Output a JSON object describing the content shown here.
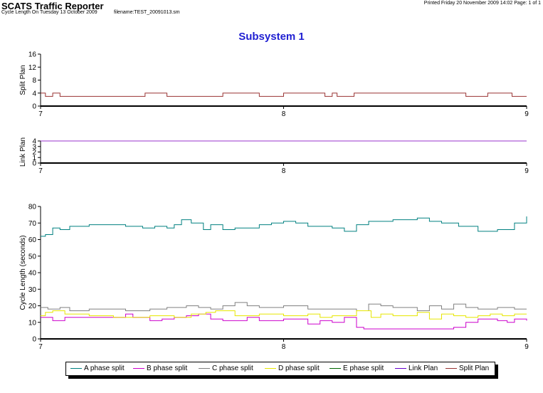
{
  "header": {
    "app_title": "SCATS Traffic Reporter",
    "subtitle": "Cycle Length On Tuesday 13 October 2009",
    "filename": "filename:TEST_20091013.sm",
    "printed": "Printed Friday 20 November 2009 14:02  Page: 1 of 1"
  },
  "chart_title": "Subsystem 1",
  "chart_data": [
    {
      "type": "line",
      "ylabel": "Split Plan",
      "xlim": [
        7,
        9
      ],
      "ylim": [
        0,
        16
      ],
      "xticks": [
        "7",
        "8",
        "9"
      ],
      "yticks": [
        0,
        4,
        8,
        12,
        16
      ],
      "series": [
        {
          "name": "Split Plan",
          "color": "#993333",
          "x": [
            7,
            7.02,
            7.05,
            7.08,
            7.43,
            7.52,
            7.75,
            7.9,
            8.0,
            8.17,
            8.2,
            8.22,
            8.29,
            8.75,
            8.84,
            8.94,
            9
          ],
          "y": [
            4,
            3,
            4,
            3,
            4,
            3,
            4,
            3,
            4,
            3,
            4,
            3,
            4,
            3,
            4,
            3,
            3
          ]
        }
      ]
    },
    {
      "type": "line",
      "ylabel": "Link Plan",
      "xlim": [
        7,
        9
      ],
      "ylim": [
        0,
        4
      ],
      "xticks": [
        "7",
        "8",
        "9"
      ],
      "yticks": [
        0,
        1,
        2,
        3,
        4
      ],
      "series": [
        {
          "name": "Link Plan",
          "color": "#9933cc",
          "x": [
            7,
            9
          ],
          "y": [
            4,
            4
          ]
        }
      ]
    },
    {
      "type": "line",
      "ylabel": "Cycle Length (seconds)",
      "xlim": [
        7,
        9
      ],
      "ylim": [
        0,
        80
      ],
      "xticks": [
        "7",
        "8",
        "9"
      ],
      "yticks": [
        0,
        10,
        20,
        30,
        40,
        50,
        60,
        70,
        80
      ],
      "series": [
        {
          "name": "A phase split",
          "color": "#008080",
          "x": [
            7,
            7.02,
            7.05,
            7.08,
            7.12,
            7.2,
            7.35,
            7.42,
            7.47,
            7.52,
            7.55,
            7.58,
            7.62,
            7.67,
            7.7,
            7.75,
            7.8,
            7.9,
            7.95,
            8.0,
            8.05,
            8.1,
            8.2,
            8.25,
            8.3,
            8.35,
            8.45,
            8.55,
            8.6,
            8.65,
            8.72,
            8.8,
            8.88,
            8.95,
            9
          ],
          "y": [
            62,
            63,
            67,
            66,
            68,
            69,
            68,
            67,
            68,
            67,
            69,
            72,
            70,
            66,
            69,
            66,
            67,
            69,
            70,
            71,
            70,
            68,
            67,
            65,
            69,
            71,
            72,
            73,
            71,
            70,
            68,
            65,
            66,
            70,
            74
          ]
        },
        {
          "name": "B phase split",
          "color": "#cc00cc",
          "x": [
            7,
            7.05,
            7.1,
            7.2,
            7.35,
            7.38,
            7.45,
            7.5,
            7.55,
            7.6,
            7.65,
            7.7,
            7.75,
            7.85,
            7.9,
            8.0,
            8.1,
            8.15,
            8.2,
            8.25,
            8.3,
            8.33,
            8.5,
            8.65,
            8.7,
            8.75,
            8.8,
            8.88,
            8.92,
            8.95,
            9
          ],
          "y": [
            13,
            11,
            13,
            13,
            15,
            13,
            11,
            12,
            13,
            14,
            15,
            12,
            11,
            13,
            11,
            12,
            9,
            11,
            10,
            13,
            7,
            6,
            6,
            6,
            7,
            10,
            12,
            11,
            10,
            12,
            11
          ]
        },
        {
          "name": "C phase split",
          "color": "#808080",
          "x": [
            7,
            7.03,
            7.08,
            7.12,
            7.2,
            7.35,
            7.45,
            7.52,
            7.6,
            7.65,
            7.7,
            7.75,
            7.8,
            7.85,
            7.9,
            8.0,
            8.1,
            8.2,
            8.3,
            8.35,
            8.4,
            8.45,
            8.55,
            8.6,
            8.65,
            8.7,
            8.75,
            8.8,
            8.88,
            8.95,
            9
          ],
          "y": [
            19,
            18,
            19,
            17,
            18,
            17,
            18,
            19,
            20,
            19,
            18,
            20,
            22,
            20,
            19,
            20,
            18,
            18,
            17,
            21,
            20,
            19,
            17,
            20,
            18,
            21,
            19,
            18,
            19,
            18,
            18
          ]
        },
        {
          "name": "D phase split",
          "color": "#e6e600",
          "x": [
            7,
            7.02,
            7.05,
            7.1,
            7.2,
            7.3,
            7.45,
            7.55,
            7.62,
            7.68,
            7.72,
            7.8,
            7.9,
            8.0,
            8.1,
            8.15,
            8.2,
            8.3,
            8.36,
            8.4,
            8.45,
            8.55,
            8.6,
            8.65,
            8.7,
            8.75,
            8.8,
            8.85,
            8.9,
            8.95,
            9
          ],
          "y": [
            14,
            16,
            17,
            15,
            14,
            13,
            14,
            13,
            15,
            16,
            17,
            14,
            15,
            14,
            15,
            13,
            14,
            17,
            13,
            15,
            14,
            16,
            12,
            15,
            14,
            13,
            14,
            15,
            14,
            15,
            15
          ]
        },
        {
          "name": "E phase split",
          "color": "#006600",
          "x": [],
          "y": []
        },
        {
          "name": "Link Plan",
          "color": "#6600cc",
          "x": [],
          "y": []
        },
        {
          "name": "Split Plan",
          "color": "#993333",
          "x": [],
          "y": []
        }
      ]
    }
  ]
}
